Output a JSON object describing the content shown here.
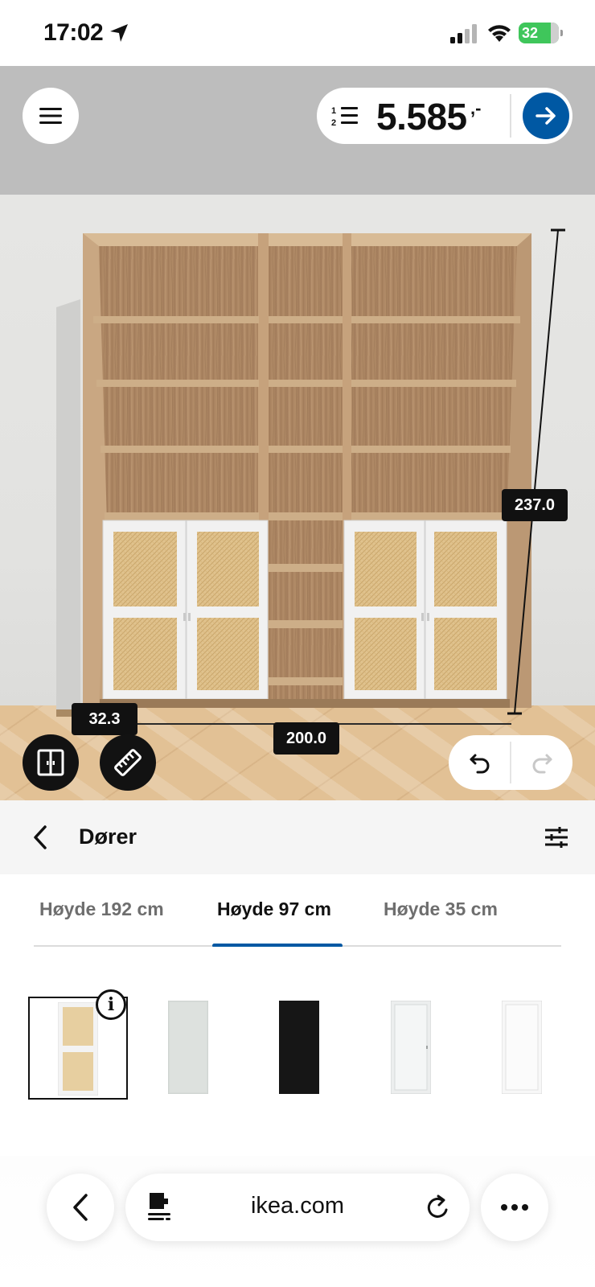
{
  "status_bar": {
    "time": "17:02",
    "battery": "32",
    "icons": [
      "location-arrow-icon",
      "cellular-signal-icon",
      "wifi-icon",
      "battery-charging-icon"
    ]
  },
  "planner": {
    "price": {
      "value": "5.585",
      "suffix": ",-"
    },
    "dimensions": {
      "height": "237.0",
      "width": "200.0",
      "depth": "32.3"
    },
    "icons": {
      "menu": "hamburger-menu-icon",
      "shopping_list": "numbered-list-icon",
      "checkout": "arrow-right-icon",
      "layout": "door-layout-icon",
      "measure": "ruler-icon",
      "undo": "undo-icon",
      "redo": "redo-icon"
    },
    "colors": {
      "accent": "#0058a3",
      "oak": "#b9936a",
      "white_frame": "#f2f2f2"
    }
  },
  "panel": {
    "title": "Dører",
    "tabs": [
      {
        "label": "Høyde 192 cm",
        "active": false
      },
      {
        "label": "Høyde 97 cm",
        "active": true
      },
      {
        "label": "Høyde 35 cm",
        "active": false
      }
    ],
    "products": [
      {
        "finish": "white frame with rattan panels",
        "color": "#e7cfa0",
        "selected": true
      },
      {
        "finish": "frosted glass",
        "color": "#d7dcd9",
        "selected": false
      },
      {
        "finish": "black",
        "color": "#161616",
        "selected": false
      },
      {
        "finish": "white glass",
        "color": "#eceeee",
        "selected": false
      },
      {
        "finish": "white",
        "color": "#f7f7f7",
        "selected": false
      }
    ]
  },
  "browser": {
    "url": "ikea.com"
  }
}
